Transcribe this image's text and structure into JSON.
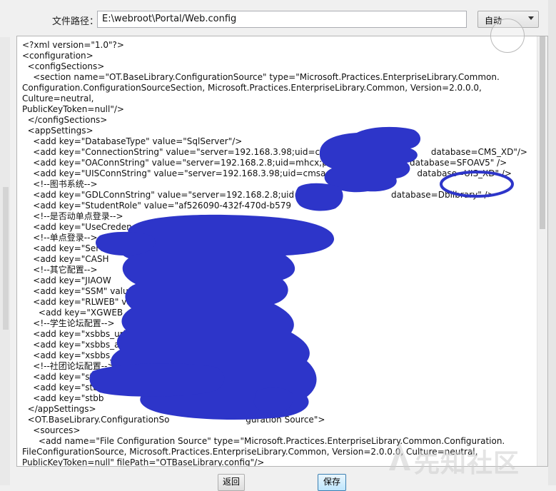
{
  "file_path": {
    "label": "文件路径：",
    "value": "E:\\webroot\\Portal/Web.config"
  },
  "encoding": {
    "selected": "自动"
  },
  "editor": {
    "lines": [
      "<?xml version=\"1.0\"?>",
      "<configuration>",
      "  <configSections>",
      "    <section name=\"OT.BaseLibrary.ConfigurationSource\" type=\"Microsoft.Practices.EnterpriseLibrary.Common.",
      "Configuration.ConfigurationSourceSection, Microsoft.Practices.EnterpriseLibrary.Common, Version=2.0.0.0, Culture=neutral,",
      "PublicKeyToken=null\"/>",
      "  </configSections>",
      "  <appSettings>",
      "    <add key=\"DatabaseType\" value=\"SqlServer\"/>",
      "    <add key=\"ConnectionString\" value=\"server=192.168.3.98;uid=cmsadmin;pwd=                database=CMS_XD\"/>",
      "    <add key=\"OAConnString\" value=\"server=192.168.2.8;uid=mhcx;pwd=                       database=SFOAV5\" />",
      "    <add key=\"UISConnString\" value=\"server=192.168.3.98;uid=cmsadmin;pw                    database=UIS_XD\" />",
      "    <!--图书系统-->",
      "    <add key=\"GDLConnString\" value=\"server=192.168.2.8;uid=                                 database=Dblibrary\" />",
      "    <add key=\"StudentRole\" value=\"af526090-432f-470d-b579",
      "    <!--是否动单点登录-->",
      "    <add key=\"UseCredence\" value=\"F\"/>",
      "    <!--单点登录-->",
      "    <add key=\"ServiceU                                                   aspx\"/>",
      "    <add key=\"CASH",
      "    <!--其它配置-->",
      "    <add key=\"JIAOW                                      ys/\" />",
      "    <add key=\"SSM\" value=\"http",
      "    <add key=\"RLWEB\" valu                                  />",
      "      <add key=\"XGWEB                                      /sys/\" />",
      "    <!--学生论坛配置-->",
      "    <add key=\"xsbbs_url                                        NT/\"/>",
      "    <add key=\"xsbbs_api                                          30c78e\"/>",
      "    <add key=\"xsbbs_sec                                         506f\"/>",
      "    <!--社团论坛配置-->",
      "    <add key=\"stbbs_url",
      "    <add key=\"stbb                                               e\"/>",
      "    <add key=\"stbb                                              />",
      "  </appSettings>",
      "  <OT.BaseLibrary.ConfigurationSo                            guration Source\">",
      "    <sources>",
      "      <add name=\"File Configuration Source\" type=\"Microsoft.Practices.EnterpriseLibrary.Common.Configuration.",
      "FileConfigurationSource, Microsoft.Practices.EnterpriseLibrary.Common, Version=2.0.0.0, Culture=neutral,",
      "PublicKeyToken=null\" filePath=\"OTBaseLibrary.config\"/>",
      "      <add name=\"System Configuration Source\" type=\"Microsoft.Practices.EnterpriseLibrary.Common.Configuration."
    ]
  },
  "buttons": {
    "back": "返回",
    "save": "保存"
  },
  "watermark": "先知社区",
  "colors": {
    "redaction": "#2d35c9",
    "accent_blue": "#3c7fb1"
  }
}
